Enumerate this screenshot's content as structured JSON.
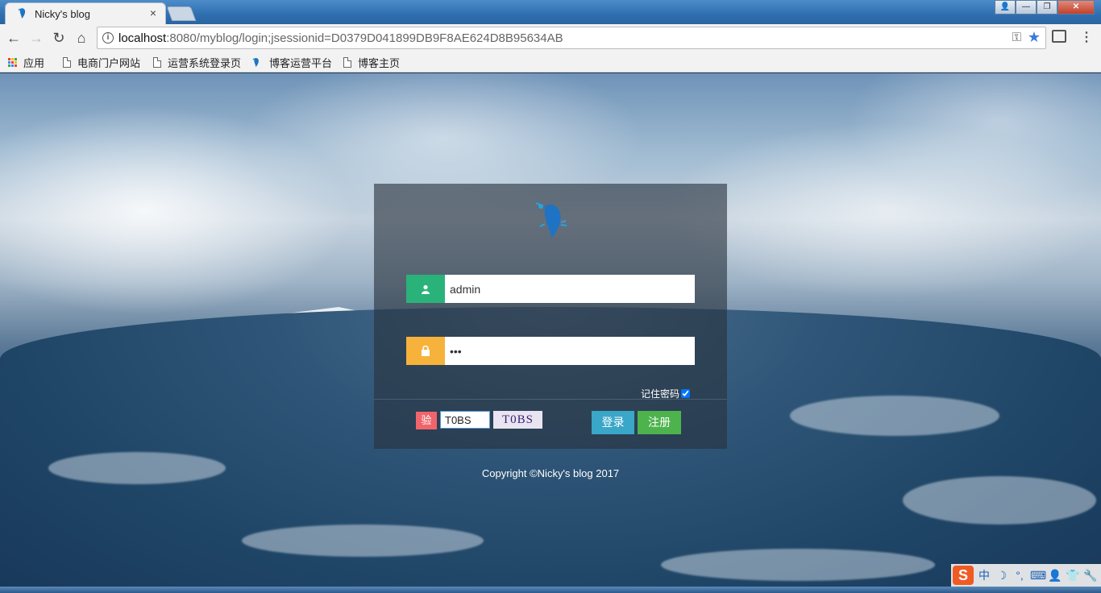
{
  "browser": {
    "tab_title": "Nicky's blog",
    "tab_close": "×",
    "url_host": "localhost",
    "url_rest": ":8080/myblog/login;jsessionid=D0379D041899DB9F8AE624D8B95634AB",
    "nav": {
      "back": "←",
      "forward": "→",
      "reload": "↻",
      "home": "⌂"
    },
    "window_buttons": [
      "👤",
      "—",
      "❐",
      "✕"
    ],
    "menu": "⋮"
  },
  "bookmarks": [
    {
      "label": "应用",
      "icon": "apps-grid-icon"
    },
    {
      "label": "电商门户网站",
      "icon": "page-icon"
    },
    {
      "label": "运营系统登录页",
      "icon": "page-icon"
    },
    {
      "label": "博客运营平台",
      "icon": "bird-logo-icon"
    },
    {
      "label": "博客主页",
      "icon": "page-icon"
    }
  ],
  "login": {
    "username_value": "admin",
    "password_value": "•••",
    "remember_label": "记住密码",
    "remember_checked": true,
    "captcha_badge": "验",
    "captcha_input_value": "T0BS",
    "captcha_image_text": "T0BS",
    "login_button": "登录",
    "register_button": "注册"
  },
  "footer": {
    "copyright": "Copyright ©Nicky's blog 2017"
  },
  "ime": {
    "logo": "S",
    "items": [
      "中",
      "☽",
      "°,",
      "⌨",
      "👤",
      "👕",
      "🔧"
    ]
  },
  "colors": {
    "user_addon": "#2ab27b",
    "lock_addon": "#f6b23b",
    "login_button": "#3aa6c8",
    "register_button": "#4db34d",
    "captcha_badge": "#f0656b"
  }
}
